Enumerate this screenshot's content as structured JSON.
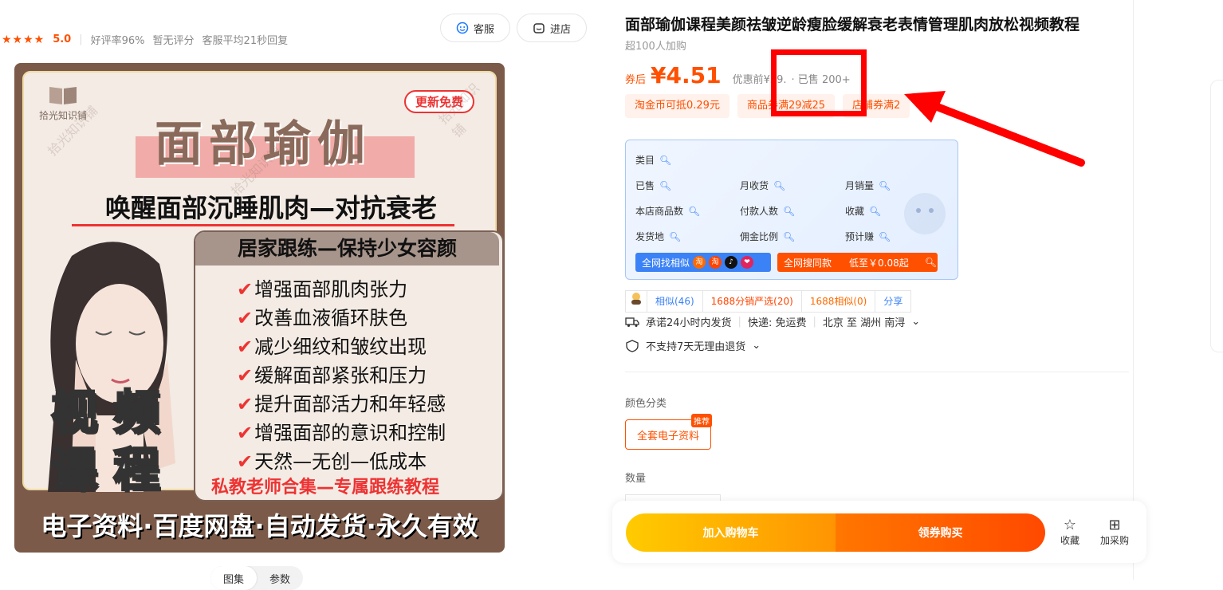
{
  "store": {
    "stars": "★★★★",
    "rating": "5.0",
    "good_rate": "好评率96%",
    "no_review": "暂无评分",
    "reply": "客服平均21秒回复",
    "service_btn": "客服",
    "shop_btn": "进店"
  },
  "image": {
    "logo": "拾光知识铺",
    "badge": "更新免费",
    "title": "面部瑜伽",
    "subtitle": "唤醒面部沉睡肌肉—对抗衰老",
    "box_head": "居家跟练—保持少女容颜",
    "features": [
      "增强面部肌肉张力",
      "改善血液循环肤色",
      "减少细纹和皱纹出现",
      "缓解面部紧张和压力",
      "提升面部活力和年轻感",
      "增强面部的意识和控制",
      "天然—无创—低成本"
    ],
    "teacher": "私教老师合集—专属跟练教程",
    "video_line1": "视 频",
    "video_line2": "课 程",
    "bottom": "电子资料·百度网盘·自动发货·永久有效",
    "watermark": "拾光知识铺"
  },
  "image_tabs": [
    "图集",
    "参数"
  ],
  "product": {
    "title": "面部瑜伽课程美颜祛皱逆龄瘦脸缓解衰老表情管理肌肉放松视频教程",
    "buyers": "超100人加购",
    "coupon_label": "券后",
    "price": "¥4.51",
    "original": "优惠前¥29.",
    "sold": "· 已售 200+",
    "tags": [
      "淘金币可抵0.29元",
      "商品券满29减25",
      "店铺券满2"
    ]
  },
  "infobox": {
    "items": [
      "类目",
      "已售",
      "月收货",
      "月销量",
      "本店商品数",
      "付款人数",
      "收藏",
      "发货地",
      "佣金比例",
      "预计赚"
    ],
    "find_similar": "全网找相似",
    "same_search": "全网搜同款",
    "lowest": "低至￥0.08起"
  },
  "similar_bar": {
    "similar": "相似(46)",
    "yan": "1688分销严选(20)",
    "s1688": "1688相似(0)",
    "share": "分享"
  },
  "shipping": {
    "promise": "承诺24小时内发货",
    "express": "快递: 免运费",
    "route": "北京 至 湖州 南浔",
    "return": "不支持7天无理由退货"
  },
  "sku": {
    "color_label": "颜色分类",
    "option": "全套电子资料",
    "badge": "推荐",
    "qty_label": "数量"
  },
  "actions": {
    "cart": "加入购物车",
    "buy": "领券购买",
    "favorite": "收藏",
    "add_purchase": "加采购"
  },
  "colors": {
    "accent": "#ff5000",
    "annotation": "#ff0000"
  }
}
